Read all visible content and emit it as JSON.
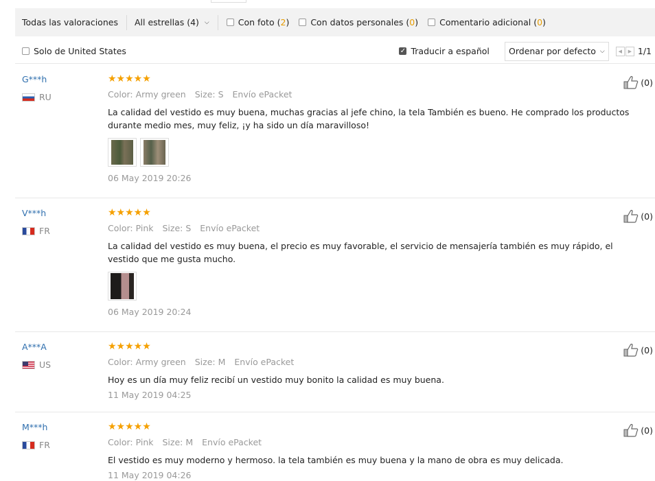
{
  "filter": {
    "all_label": "Todas las valoraciones",
    "stars_label": "All estrellas (4)",
    "options": [
      {
        "label": "Con foto",
        "count": "2",
        "checked": false
      },
      {
        "label": "Con datos personales",
        "count": "0",
        "checked": false
      },
      {
        "label": "Comentario adicional",
        "count": "0",
        "checked": false
      }
    ]
  },
  "toolbar": {
    "only_us_label": "Solo de United States",
    "translate_label": "Traducir a español",
    "translate_checked": true,
    "sort_label": "Ordenar por defecto",
    "page_info": "1/1"
  },
  "reviews": [
    {
      "user": "G***h",
      "country": "RU",
      "flag": "ru",
      "stars": "★★★★★",
      "color": "Color: Army green",
      "size": "Size: S",
      "shipping": "Envío ePacket",
      "text": "La calidad del vestido es muy buena, muchas gracias al jefe chino, la tela También es bueno. He comprado los productos durante medio mes, muy feliz, ¡y ha sido un día maravilloso!",
      "photos": 2,
      "date": "06 May 2019 20:26",
      "likes": "(0)"
    },
    {
      "user": "V***h",
      "country": "FR",
      "flag": "fr",
      "stars": "★★★★★",
      "color": "Color: Pink",
      "size": "Size: S",
      "shipping": "Envío ePacket",
      "text": "La calidad del vestido es muy buena, el precio es muy favorable, el servicio de mensajería también es muy rápido, el vestido que me gusta mucho.",
      "photos": 1,
      "date": "06 May 2019 20:24",
      "likes": "(0)"
    },
    {
      "user": "A***A",
      "country": "US",
      "flag": "us",
      "stars": "★★★★★",
      "color": "Color: Army green",
      "size": "Size: M",
      "shipping": "Envío ePacket",
      "text": "Hoy es un día muy feliz recibí un vestido muy bonito la calidad es muy buena.",
      "photos": 0,
      "date": "11 May 2019 04:25",
      "likes": "(0)"
    },
    {
      "user": "M***h",
      "country": "FR",
      "flag": "fr",
      "stars": "★★★★★",
      "color": "Color: Pink",
      "size": "Size: M",
      "shipping": "Envío ePacket",
      "text": "El vestido es muy moderno y hermoso. la tela también es muy buena y la mano de obra es muy delicada.",
      "photos": 0,
      "date": "11 May 2019 04:26",
      "likes": "(0)"
    }
  ],
  "colors": {
    "accent_count": "#e69b00",
    "star": "#f5a000",
    "username": "#2f6fae",
    "meta": "#999999"
  }
}
